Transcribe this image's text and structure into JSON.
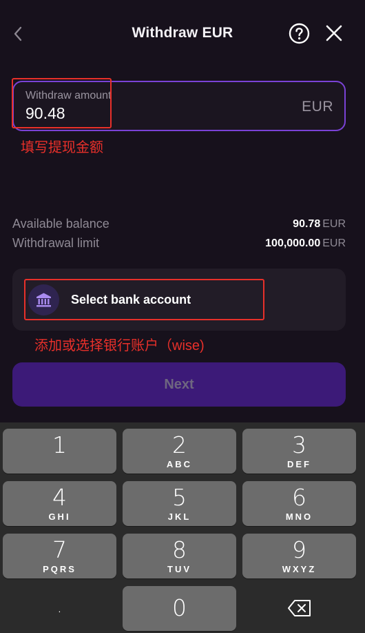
{
  "header": {
    "title": "Withdraw EUR",
    "help_icon": "question-circle-icon",
    "close_icon": "close-icon",
    "back_icon": "chevron-left-icon"
  },
  "amount_field": {
    "label": "Withdraw amount",
    "value": "90.48",
    "currency": "EUR"
  },
  "annotations": {
    "amount_note": "填写提现金额",
    "bank_note": "添加或选择银行账户（wise)"
  },
  "info": {
    "balance_label": "Available balance",
    "balance_value": "90.78",
    "balance_currency": "EUR",
    "limit_label": "Withdrawal limit",
    "limit_value": "100,000.00",
    "limit_currency": "EUR"
  },
  "bank": {
    "icon": "bank-icon",
    "label": "Select bank account"
  },
  "next_button": {
    "label": "Next"
  },
  "keypad": {
    "keys": [
      {
        "num": "1",
        "letters": ""
      },
      {
        "num": "2",
        "letters": "ABC"
      },
      {
        "num": "3",
        "letters": "DEF"
      },
      {
        "num": "4",
        "letters": "GHI"
      },
      {
        "num": "5",
        "letters": "JKL"
      },
      {
        "num": "6",
        "letters": "MNO"
      },
      {
        "num": "7",
        "letters": "PQRS"
      },
      {
        "num": "8",
        "letters": "TUV"
      },
      {
        "num": "9",
        "letters": "WXYZ"
      },
      {
        "num": ".",
        "letters": ""
      },
      {
        "num": "0",
        "letters": ""
      }
    ],
    "delete_icon": "backspace-icon"
  },
  "colors": {
    "background": "#17111c",
    "accent_border": "#7a42d6",
    "button_disabled": "#3c1a78",
    "annotation_red": "#e8302a",
    "key_bg": "#6c6c6c"
  }
}
